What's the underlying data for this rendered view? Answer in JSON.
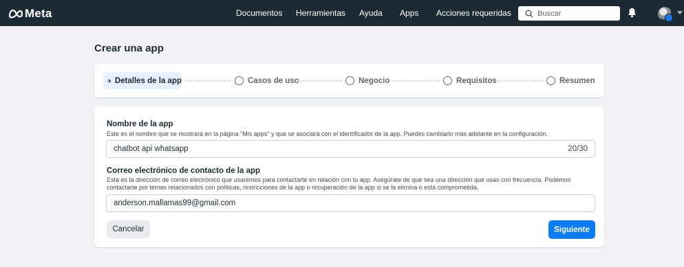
{
  "header": {
    "logo_text": "Meta",
    "nav": [
      {
        "label": "Documentos"
      },
      {
        "label": "Herramientas"
      },
      {
        "label": "Ayuda"
      },
      {
        "label": "Apps"
      },
      {
        "label": "Acciones requeridas"
      }
    ],
    "search": {
      "placeholder": "Buscar",
      "value": ""
    }
  },
  "page": {
    "title": "Crear una app"
  },
  "stepper": {
    "steps": [
      {
        "label": "Detalles de la app",
        "state": "active"
      },
      {
        "label": "Casos de uso",
        "state": "pending"
      },
      {
        "label": "Negocio",
        "state": "pending"
      },
      {
        "label": "Requisitos",
        "state": "pending"
      },
      {
        "label": "Resumen",
        "state": "pending"
      }
    ]
  },
  "form": {
    "app_name": {
      "label": "Nombre de la app",
      "help": "Este es el nombre que se mostrará en la página \"Mis apps\" y que se asociará con el identificador de la app. Puedes cambiarlo más adelante en la configuración.",
      "value": "chatbot api whatsapp",
      "counter": "20/30"
    },
    "contact_email": {
      "label": "Correo electrónico de contacto de la app",
      "help": "Esta es la dirección de correo electrónico que usaremos para contactarte en relación con tu app. Asegúrate de que sea una dirección que usas con frecuencia. Podemos contactarte por temas relacionados con políticas, restricciones de la app o recuperación de la app si se la elimina o está comprometida.",
      "value": "anderson.mallamas99@gmail.com"
    },
    "cancel_label": "Cancelar",
    "next_label": "Siguiente"
  },
  "colors": {
    "topbar": "#1c2b33",
    "primary": "#0a7cf5",
    "active_step_bg": "#e7f0fc"
  }
}
